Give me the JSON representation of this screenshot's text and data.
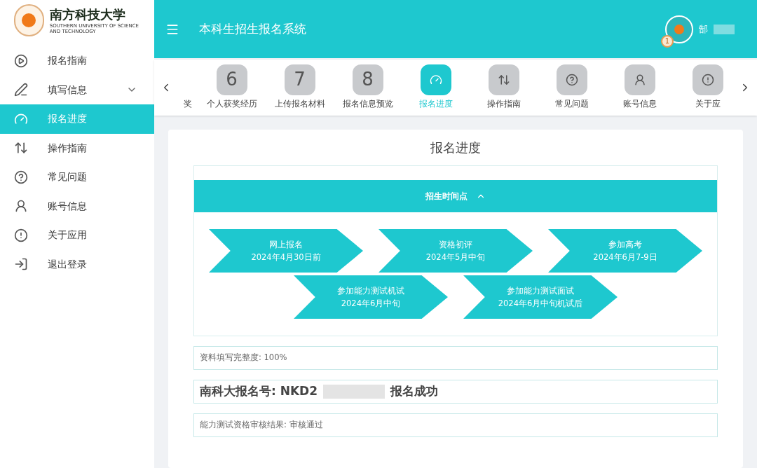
{
  "logo": {
    "name": "南方科技大学",
    "subtitle": "SOUTHERN UNIVERSITY OF SCIENCE AND TECHNOLOGY"
  },
  "sidebar": {
    "items": [
      {
        "label": "报名指南",
        "selected": false
      },
      {
        "label": "填写信息",
        "selected": false,
        "expanded": false
      },
      {
        "label": "报名进度",
        "selected": true
      },
      {
        "label": "操作指南",
        "selected": false
      },
      {
        "label": "常见问题",
        "selected": false
      },
      {
        "label": "账号信息",
        "selected": false
      },
      {
        "label": "关于应用",
        "selected": false
      },
      {
        "label": "退出登录",
        "selected": false
      }
    ]
  },
  "header": {
    "title": "本科生招生报名系统",
    "user": {
      "name": "郜",
      "badge": "1"
    }
  },
  "steps": [
    {
      "kind": "label",
      "label": "奖",
      "selected": false
    },
    {
      "kind": "number",
      "number": "6",
      "label": "个人获奖经历",
      "selected": false
    },
    {
      "kind": "number",
      "number": "7",
      "label": "上传报名材料",
      "selected": false
    },
    {
      "kind": "number",
      "number": "8",
      "label": "报名信息预览",
      "selected": false
    },
    {
      "kind": "icon",
      "label": "报名进度",
      "selected": true
    },
    {
      "kind": "icon",
      "label": "操作指南",
      "selected": false
    },
    {
      "kind": "icon",
      "label": "常见问题",
      "selected": false
    },
    {
      "kind": "icon",
      "label": "账号信息",
      "selected": false
    },
    {
      "kind": "icon",
      "label": "关于应",
      "selected": false
    }
  ],
  "page": {
    "title": "报名进度",
    "timeline": {
      "title": "招生时间点",
      "expanded": true,
      "items": [
        {
          "title": "网上报名",
          "date": "2024年4月30日前"
        },
        {
          "title": "资格初评",
          "date": "2024年5月中旬"
        },
        {
          "title": "参加高考",
          "date": "2024年6月7-9日"
        },
        {
          "title": "参加能力测试机试",
          "date": "2024年6月中旬"
        },
        {
          "title": "参加能力测试面试",
          "date": "2024年6月中旬机试后"
        }
      ]
    },
    "completeness": "资料填写完整度: 100%",
    "registration": {
      "label": "南科大报名号: NKD2",
      "status": "报名成功"
    },
    "review": "能力测试资格审核结果: 审核通过"
  }
}
